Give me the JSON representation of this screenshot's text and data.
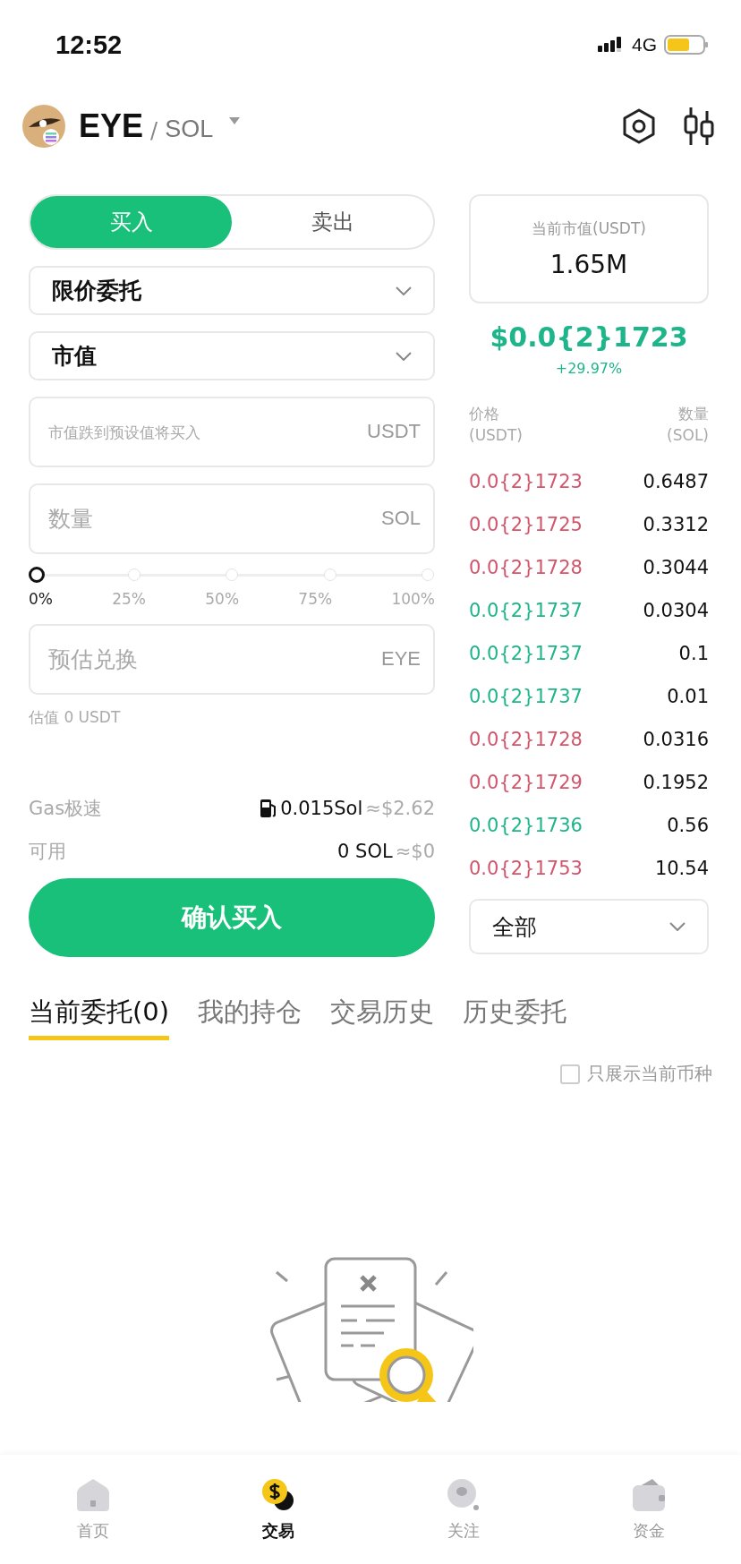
{
  "status_bar": {
    "time": "12:52",
    "network": "4G"
  },
  "header": {
    "token": "EYE",
    "separator": "/",
    "quote": "SOL"
  },
  "side_tabs": [
    {
      "label": "买入",
      "selected": true
    },
    {
      "label": "卖出",
      "selected": false
    }
  ],
  "order_type": {
    "value": "限价委托"
  },
  "trigger_type": {
    "value": "市值"
  },
  "fields": [
    {
      "placeholder": "市值跌到预设值将买入",
      "unit": "USDT"
    },
    {
      "placeholder": "数量",
      "unit": "SOL"
    }
  ],
  "slider": {
    "level": 0,
    "marks": [
      "0%",
      "25%",
      "50%",
      "75%",
      "100%"
    ]
  },
  "estimate_field": {
    "placeholder": "预估兑换",
    "unit": "EYE"
  },
  "estimate_value": "估值 0 USDT",
  "gas": {
    "label": "Gas极速",
    "amount": "0.015Sol",
    "approx": "≈$2.62"
  },
  "available": {
    "label": "可用",
    "amount": "0 SOL",
    "approx": "≈$0"
  },
  "submit": "确认买入",
  "market_cap": {
    "label": "当前市值(USDT)",
    "value": "1.65M"
  },
  "last_price": "$0.0{2}1723",
  "change": "+29.97%",
  "order_book": {
    "columns": [
      {
        "label": "价格",
        "unit": "(USDT)"
      },
      {
        "label": "数量",
        "unit": "(SOL)"
      }
    ],
    "rows": [
      {
        "price": "0.0{2}1723",
        "amount": "0.6487",
        "color": "#d2556b"
      },
      {
        "price": "0.0{2}1725",
        "amount": "0.3312",
        "color": "#d2556b"
      },
      {
        "price": "0.0{2}1728",
        "amount": "0.3044",
        "color": "#d2556b"
      },
      {
        "price": "0.0{2}1737",
        "amount": "0.0304",
        "color": "#1fb58a"
      },
      {
        "price": "0.0{2}1737",
        "amount": "0.1",
        "color": "#1fb58a"
      },
      {
        "price": "0.0{2}1737",
        "amount": "0.01",
        "color": "#1fb58a"
      },
      {
        "price": "0.0{2}1728",
        "amount": "0.0316",
        "color": "#d2556b"
      },
      {
        "price": "0.0{2}1729",
        "amount": "0.1952",
        "color": "#d2556b"
      },
      {
        "price": "0.0{2}1736",
        "amount": "0.56",
        "color": "#1fb58a"
      },
      {
        "price": "0.0{2}1753",
        "amount": "10.54",
        "color": "#d2556b"
      }
    ]
  },
  "filter": {
    "value": "全部"
  },
  "order_tabs": [
    {
      "label": "当前委托(0)",
      "selected": true
    },
    {
      "label": "我的持仓",
      "selected": false
    },
    {
      "label": "交易历史",
      "selected": false
    },
    {
      "label": "历史委托",
      "selected": false
    }
  ],
  "only_current": {
    "label": "只展示当前币种",
    "checked": false
  },
  "nav": [
    {
      "label": "首页",
      "kind": "home",
      "selected": false
    },
    {
      "label": "交易",
      "kind": "trade",
      "selected": true
    },
    {
      "label": "关注",
      "kind": "watch",
      "selected": false
    },
    {
      "label": "资金",
      "kind": "wallet",
      "selected": false
    }
  ]
}
